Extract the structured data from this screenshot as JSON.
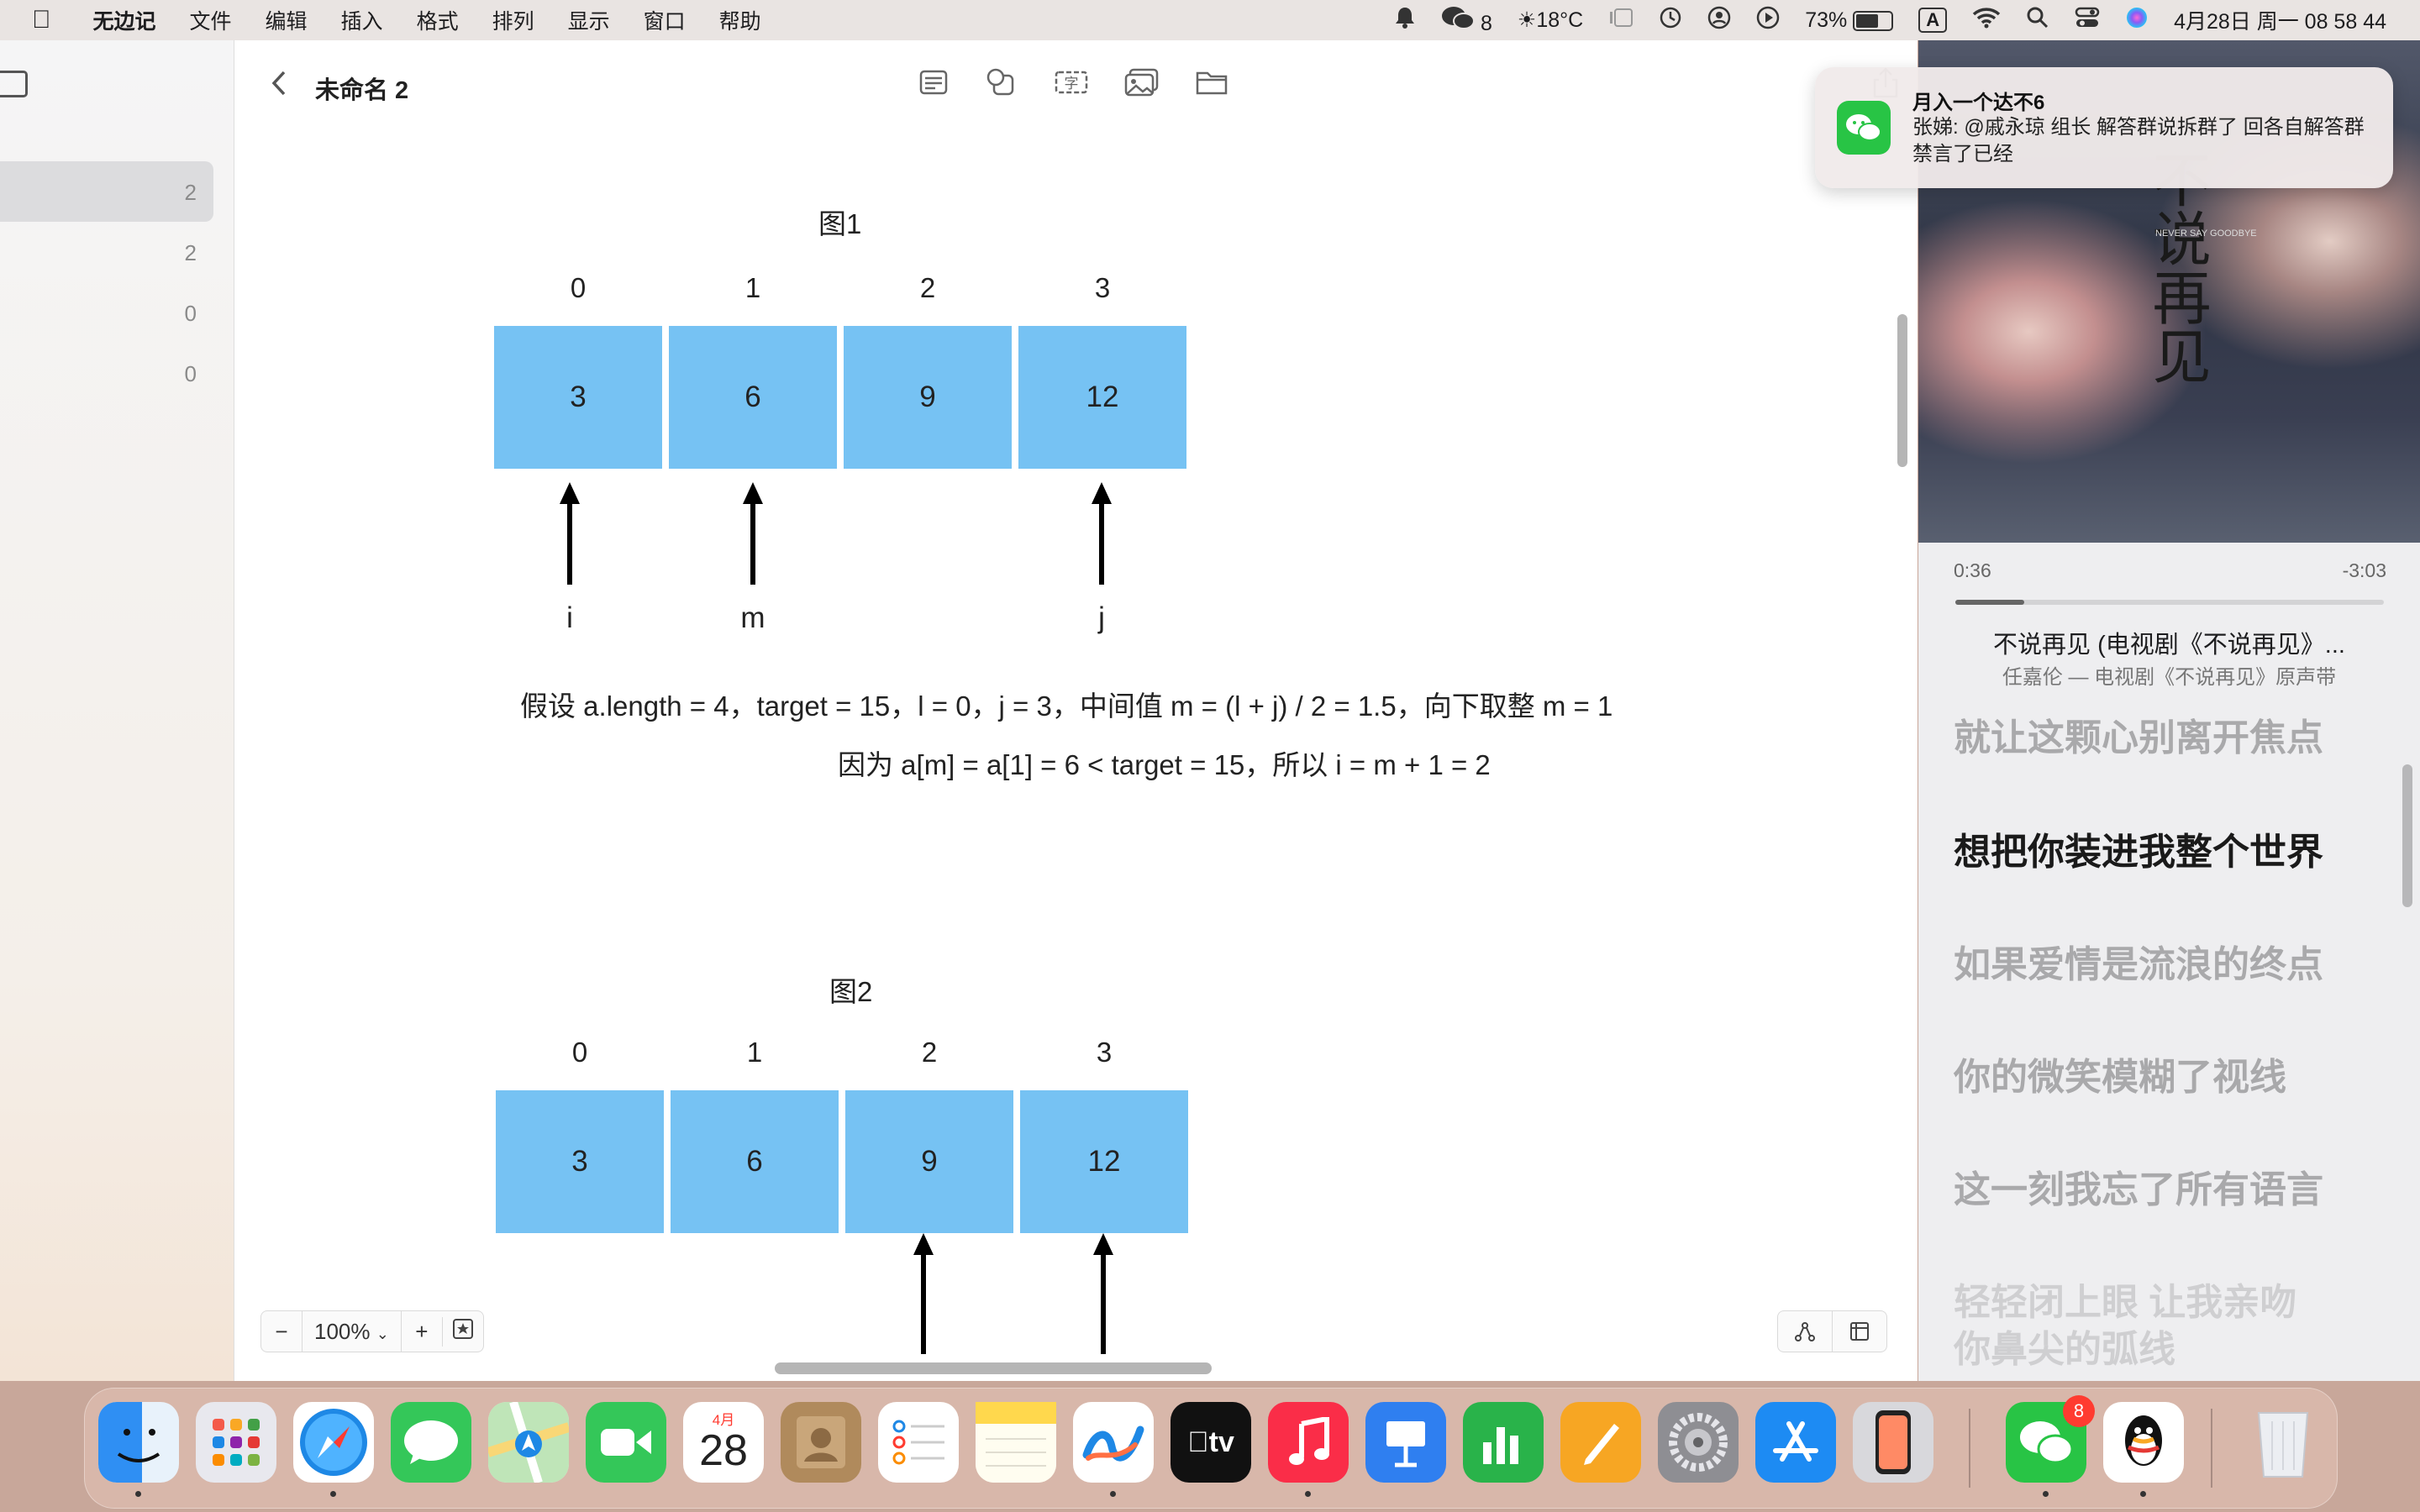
{
  "menubar": {
    "apple": "",
    "app_name": "无边记",
    "menus": [
      "文件",
      "编辑",
      "插入",
      "格式",
      "排列",
      "显示",
      "窗口",
      "帮助"
    ],
    "wechat_count": "8",
    "weather": "18°C",
    "battery_percent": "73%",
    "battery_level": 0.73,
    "input_method": "A",
    "datetime": "4月28日 周一  08 58 44"
  },
  "sidebar": {
    "rows": [
      {
        "count": "2",
        "selected": true
      },
      {
        "count": "2",
        "selected": false
      },
      {
        "count": "0",
        "selected": false
      },
      {
        "count": "0",
        "selected": false
      }
    ]
  },
  "toolbar": {
    "back_icon": "chevron-left-icon",
    "title": "未命名 2",
    "tools": [
      "sticky-note-icon",
      "shapes-icon",
      "text-box-icon",
      "media-icon",
      "folder-icon"
    ],
    "share_icon": "share-icon"
  },
  "canvas": {
    "fig1": {
      "title": "图1",
      "indices": [
        "0",
        "1",
        "2",
        "3"
      ],
      "values": [
        "3",
        "6",
        "9",
        "12"
      ],
      "pointers": [
        "i",
        "m",
        "j"
      ]
    },
    "explanation": {
      "line1": "假设 a.length = 4，target = 15，l = 0，j = 3，中间值 m = (l + j) / 2 = 1.5，向下取整 m = 1",
      "line2": "因为 a[m] = a[1] = 6 < target = 15，所以 i = m + 1 = 2"
    },
    "fig2": {
      "title": "图2",
      "indices": [
        "0",
        "1",
        "2",
        "3"
      ],
      "values": [
        "3",
        "6",
        "9",
        "12"
      ]
    }
  },
  "zoom": {
    "minus": "−",
    "level": "100%",
    "plus": "+"
  },
  "music": {
    "cover_text": "不说再见",
    "cover_tiny": "NEVER SAY GOODBYE",
    "elapsed": "0:36",
    "remaining": "-3:03",
    "progress": 0.16,
    "song_title": "不说再见 (电视剧《不说再见》...",
    "song_subtitle": "任嘉伦 — 电视剧《不说再见》原声带",
    "lyrics": [
      "就让这颗心别离开焦点",
      "想把你装进我整个世界",
      "如果爱情是流浪的终点",
      "你的微笑模糊了视线",
      "这一刻我忘了所有语言",
      "轻轻闭上眼 让我亲吻",
      "你鼻尖的弧线"
    ]
  },
  "notification": {
    "app_icon": "wechat-icon",
    "title": "月入一个达不6",
    "body": "张娣: @戚永琼 组长 解答群说拆群了 回各自解答群 禁言了已经"
  },
  "dock": {
    "apps": [
      {
        "name": "finder",
        "color": "#2f8ff3",
        "running": true
      },
      {
        "name": "launchpad",
        "color": "#e8e8ee",
        "running": false
      },
      {
        "name": "safari",
        "color": "#1e88e5",
        "running": true
      },
      {
        "name": "messages",
        "color": "#34c759",
        "running": false
      },
      {
        "name": "maps",
        "color": "#6fcf73",
        "running": false
      },
      {
        "name": "facetime",
        "color": "#34c759",
        "running": false
      },
      {
        "name": "calendar",
        "color": "#ffffff",
        "running": false
      },
      {
        "name": "contacts",
        "color": "#b08a5c",
        "running": false
      },
      {
        "name": "reminders",
        "color": "#ffffff",
        "running": false
      },
      {
        "name": "notes",
        "color": "#fff6c8",
        "running": false
      },
      {
        "name": "freeform",
        "color": "#ffffff",
        "running": true
      },
      {
        "name": "apple-tv",
        "color": "#111111",
        "running": false
      },
      {
        "name": "music",
        "color": "#fa2d48",
        "running": true
      },
      {
        "name": "keynote",
        "color": "#2f7ff0",
        "running": false
      },
      {
        "name": "numbers",
        "color": "#29b34a",
        "running": false
      },
      {
        "name": "pages",
        "color": "#f7a623",
        "running": false
      },
      {
        "name": "system-settings",
        "color": "#8e8e93",
        "running": false
      },
      {
        "name": "app-store",
        "color": "#1d8bf3",
        "running": false
      },
      {
        "name": "iphone-mirroring",
        "color": "#d8d8dc",
        "running": false
      },
      {
        "name": "wechat",
        "color": "#28c445",
        "running": true,
        "badge": "8"
      },
      {
        "name": "qq",
        "color": "#ffffff",
        "running": true
      },
      {
        "name": "trash",
        "color": "#e6e6ea",
        "running": false
      }
    ],
    "calendar_month": "4月",
    "calendar_day": "28",
    "tv_label": "tv"
  }
}
